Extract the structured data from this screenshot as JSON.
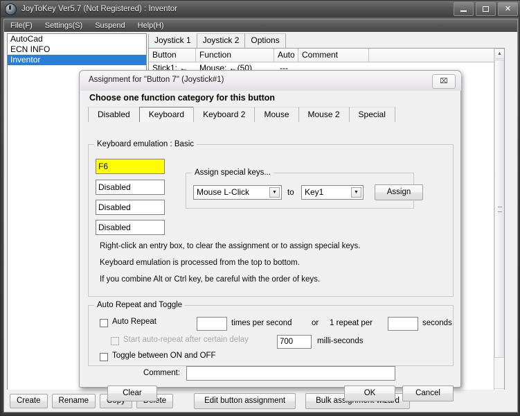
{
  "window": {
    "title": "JoyToKey Ver5.7 (Not Registered) : Inventor",
    "icon": "joystick-icon",
    "controls": {
      "minimize": "minimize-icon",
      "maximize": "maximize-icon",
      "close": "✕"
    }
  },
  "menubar": {
    "items": [
      {
        "label": "File(F)"
      },
      {
        "label": "Settings(S)"
      },
      {
        "label": "Suspend"
      },
      {
        "label": "Help(H)"
      }
    ]
  },
  "profiles": {
    "items": [
      {
        "label": "AutoCad",
        "selected": false
      },
      {
        "label": "ECN INFO",
        "selected": false
      },
      {
        "label": "Inventor",
        "selected": true
      }
    ]
  },
  "main_tabs": [
    {
      "label": "Joystick 1",
      "active": true
    },
    {
      "label": "Joystick 2",
      "active": false
    },
    {
      "label": "Options",
      "active": false
    }
  ],
  "table": {
    "columns": [
      "Button",
      "Function",
      "Auto",
      "Comment",
      ""
    ],
    "rows": [
      {
        "button": "Stick1: ←",
        "function": "Mouse: ←(50)",
        "auto": "---",
        "comment": ""
      }
    ]
  },
  "bottom_bar": {
    "profile_buttons": [
      "Create",
      "Rename",
      "Copy",
      "Delete"
    ],
    "action_buttons": [
      "Edit button assignment",
      "Bulk assignment wizard"
    ]
  },
  "dialog": {
    "title": "Assignment for \"Button 7\" (Joystick#1)",
    "close_glyph": "⌧",
    "heading": "Choose one function category for this button",
    "tabs": [
      {
        "label": "Disabled",
        "active": false
      },
      {
        "label": "Keyboard",
        "active": true
      },
      {
        "label": "Keyboard 2",
        "active": false
      },
      {
        "label": "Mouse",
        "active": false
      },
      {
        "label": "Mouse 2",
        "active": false
      },
      {
        "label": "Special",
        "active": false
      }
    ],
    "keyboard_group": {
      "title": "Keyboard emulation : Basic",
      "key_fields": [
        {
          "value": "F6",
          "highlight": true
        },
        {
          "value": "Disabled",
          "highlight": false
        },
        {
          "value": "Disabled",
          "highlight": false
        },
        {
          "value": "Disabled",
          "highlight": false
        }
      ],
      "special_keys": {
        "title": "Assign special keys...",
        "source_value": "Mouse L-Click",
        "to_label": "to",
        "target_value": "Key1",
        "assign_label": "Assign"
      },
      "info_lines": [
        "Right-click an entry box, to clear the assignment or to assign special keys.",
        "Keyboard emulation is processed from the top to bottom.",
        "If you combine Alt or Ctrl key, be careful with the order of keys."
      ]
    },
    "auto_repeat_group": {
      "title": "Auto Repeat and Toggle",
      "auto_repeat_label": "Auto Repeat",
      "auto_repeat_checked": false,
      "rate_value": "",
      "times_per_second_label": "times per second",
      "or_label": "or",
      "one_repeat_per_label": "1 repeat per",
      "seconds_value": "",
      "seconds_label": "seconds",
      "delay_label": "Start auto-repeat after certain delay",
      "delay_checked": false,
      "delay_enabled": false,
      "delay_value": "700",
      "milliseconds_label": "milli-seconds",
      "toggle_label": "Toggle between ON and OFF",
      "toggle_checked": false
    },
    "comment": {
      "label": "Comment:",
      "value": "",
      "placeholder": ""
    },
    "buttons": {
      "clear": "Clear",
      "ok": "OK",
      "cancel": "Cancel"
    }
  },
  "colors": {
    "highlight_yellow": "#ffff00",
    "selection_blue": "#2a7fd4",
    "dialog_bg": "#f0f0f0"
  }
}
